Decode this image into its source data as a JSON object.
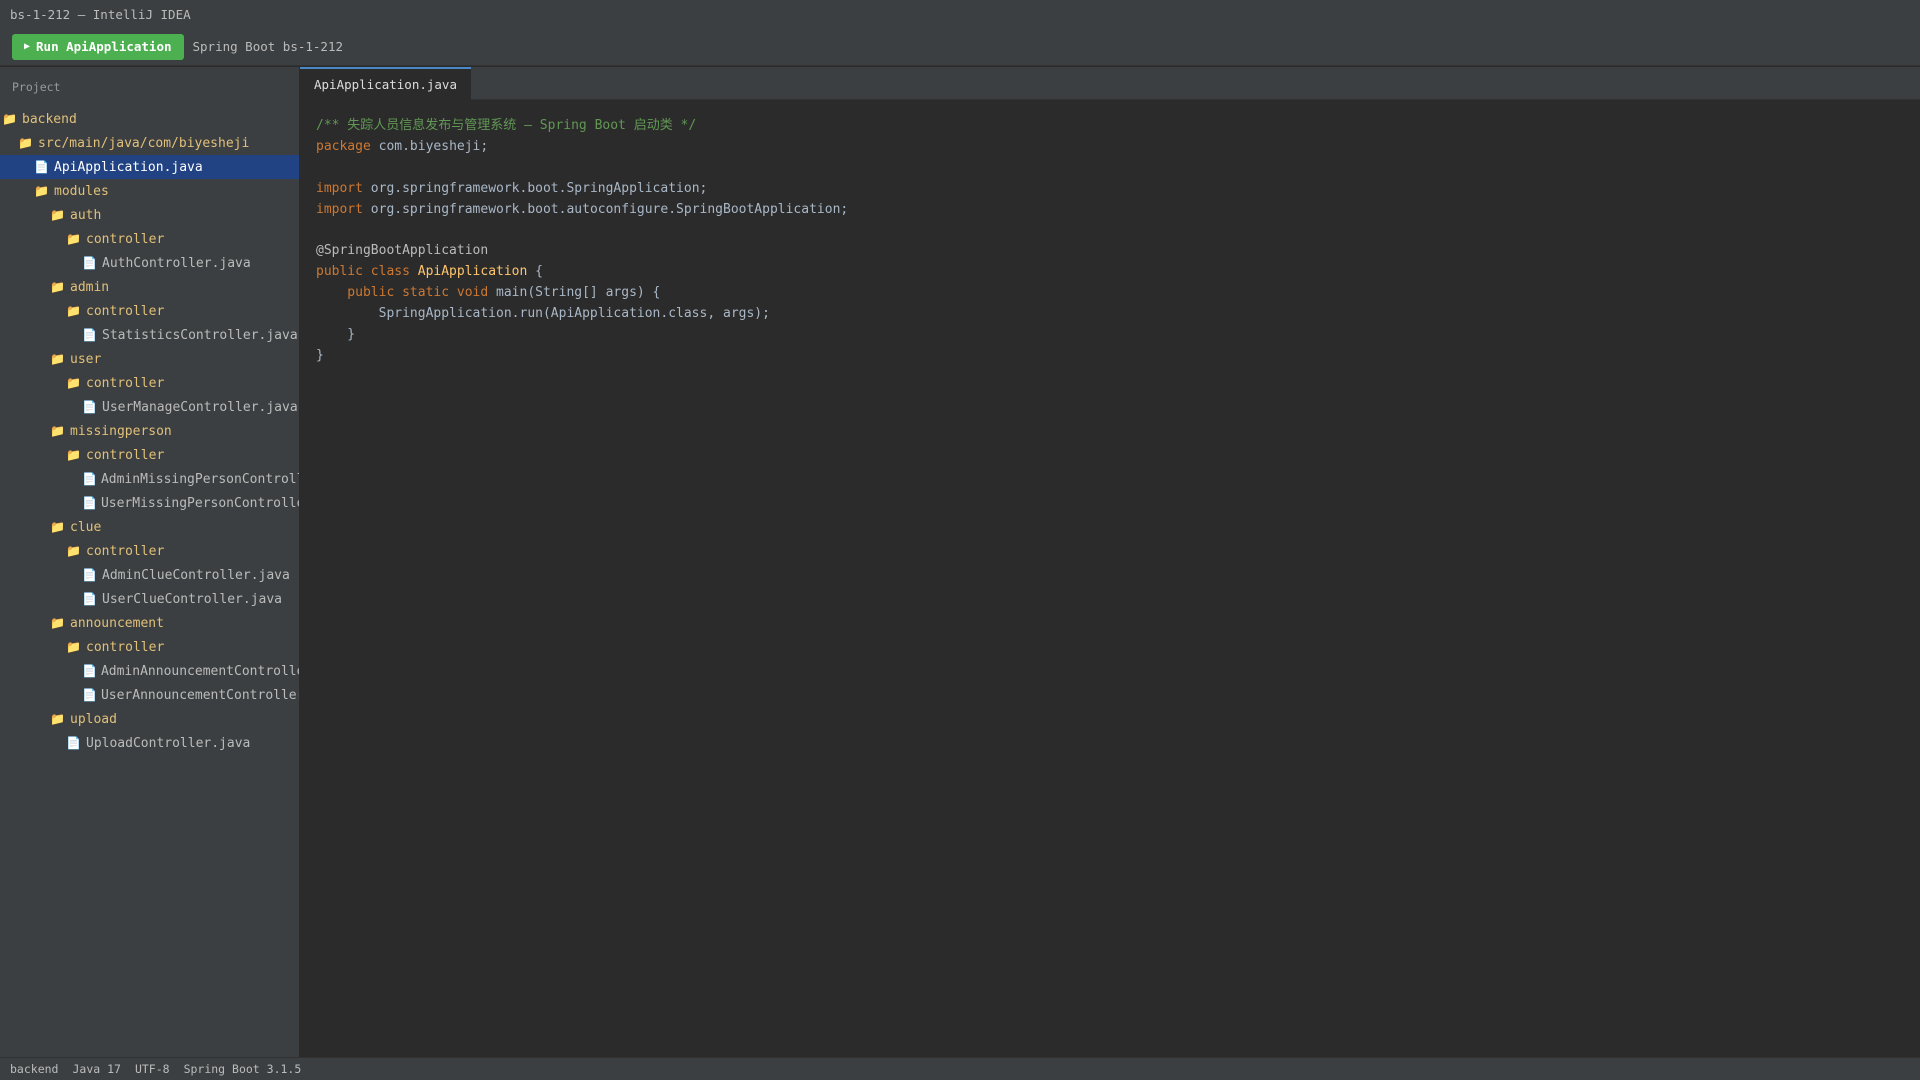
{
  "window": {
    "title": "bs-1-212 — IntelliJ IDEA"
  },
  "toolbar": {
    "run_label": "Run ApiApplication",
    "run_config": "Spring Boot bs-1-212"
  },
  "sidebar": {
    "header": "Project",
    "items": [
      {
        "label": "backend",
        "type": "folder",
        "depth": 0,
        "selected": false
      },
      {
        "label": "src/main/java/com/biyesheji",
        "type": "folder",
        "depth": 1,
        "selected": false
      },
      {
        "label": "ApiApplication.java",
        "type": "file",
        "depth": 2,
        "selected": true
      },
      {
        "label": "modules",
        "type": "folder",
        "depth": 2,
        "selected": false
      },
      {
        "label": "auth",
        "type": "folder",
        "depth": 3,
        "selected": false
      },
      {
        "label": "controller",
        "type": "folder",
        "depth": 4,
        "selected": false
      },
      {
        "label": "AuthController.java",
        "type": "file",
        "depth": 5,
        "selected": false
      },
      {
        "label": "admin",
        "type": "folder",
        "depth": 3,
        "selected": false
      },
      {
        "label": "controller",
        "type": "folder",
        "depth": 4,
        "selected": false
      },
      {
        "label": "StatisticsController.java",
        "type": "file",
        "depth": 5,
        "selected": false
      },
      {
        "label": "user",
        "type": "folder",
        "depth": 3,
        "selected": false
      },
      {
        "label": "controller",
        "type": "folder",
        "depth": 4,
        "selected": false
      },
      {
        "label": "UserManageController.java",
        "type": "file",
        "depth": 5,
        "selected": false
      },
      {
        "label": "missingperson",
        "type": "folder",
        "depth": 3,
        "selected": false
      },
      {
        "label": "controller",
        "type": "folder",
        "depth": 4,
        "selected": false
      },
      {
        "label": "AdminMissingPersonController.java",
        "type": "file",
        "depth": 5,
        "selected": false
      },
      {
        "label": "UserMissingPersonController.java",
        "type": "file",
        "depth": 5,
        "selected": false
      },
      {
        "label": "clue",
        "type": "folder",
        "depth": 3,
        "selected": false
      },
      {
        "label": "controller",
        "type": "folder",
        "depth": 4,
        "selected": false
      },
      {
        "label": "AdminClueController.java",
        "type": "file",
        "depth": 5,
        "selected": false
      },
      {
        "label": "UserClueController.java",
        "type": "file",
        "depth": 5,
        "selected": false
      },
      {
        "label": "announcement",
        "type": "folder",
        "depth": 3,
        "selected": false
      },
      {
        "label": "controller",
        "type": "folder",
        "depth": 4,
        "selected": false
      },
      {
        "label": "AdminAnnouncementController.java",
        "type": "file",
        "depth": 5,
        "selected": false
      },
      {
        "label": "UserAnnouncementController.java",
        "type": "file",
        "depth": 5,
        "selected": false
      },
      {
        "label": "upload",
        "type": "folder",
        "depth": 3,
        "selected": false
      },
      {
        "label": "UploadController.java",
        "type": "file",
        "depth": 4,
        "selected": false
      }
    ]
  },
  "editor": {
    "tabs": [
      {
        "label": "ApiApplication.java",
        "active": true
      }
    ],
    "code_lines": [
      [
        {
          "t": "/** 失踪人员信息发布与管理系统 — Spring Boot 启动类 */",
          "c": "comment"
        }
      ],
      [
        {
          "t": "package",
          "c": "kw"
        },
        {
          "t": " com.biyesheji;",
          "c": "plain"
        }
      ],
      [],
      [
        {
          "t": "import",
          "c": "kw"
        },
        {
          "t": " org.springframework.boot.SpringApplication;",
          "c": "plain"
        }
      ],
      [
        {
          "t": "import",
          "c": "kw"
        },
        {
          "t": " org.springframework.boot.autoconfigure.SpringBootApplication;",
          "c": "plain"
        }
      ],
      [],
      [
        {
          "t": "@SpringBootApplication",
          "c": "annot"
        }
      ],
      [
        {
          "t": "public class ",
          "c": "kw"
        },
        {
          "t": "ApiApplication",
          "c": "cls"
        },
        {
          "t": " {",
          "c": "plain"
        }
      ],
      [
        {
          "t": "    public static void ",
          "c": "kw"
        },
        {
          "t": "main(String[] args) {",
          "c": "plain"
        }
      ],
      [
        {
          "t": "        SpringApplication.run(ApiApplication.class, args);",
          "c": "plain"
        }
      ],
      [
        {
          "t": "    }",
          "c": "plain"
        }
      ],
      [
        {
          "t": "}",
          "c": "plain"
        }
      ]
    ]
  },
  "statusbar": {
    "items": [
      "backend",
      "Java 17",
      "UTF-8",
      "Spring Boot 3.1.5"
    ]
  },
  "icons": {
    "folder": "folder-icon",
    "file": "file-icon",
    "run": "play-icon"
  }
}
